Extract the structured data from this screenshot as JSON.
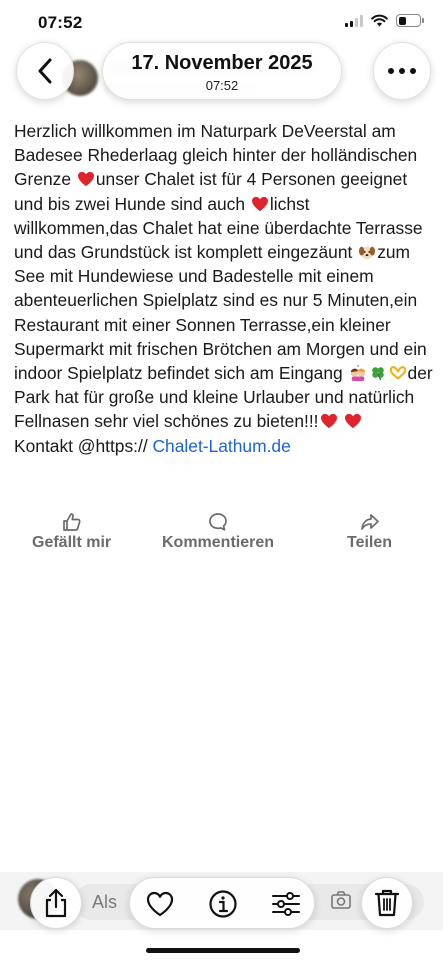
{
  "status_bar": {
    "time": "07:52"
  },
  "header": {
    "date": "17. November 2025",
    "time": "07:52"
  },
  "post": {
    "text_segments": [
      "Herzlich willkommen im Naturpark DeVeerstal am Badesee Rhederlaag gleich hinter der holländischen Grenze ",
      "unser Chalet ist für 4 Personen geeignet und bis zwei Hunde sind auch ",
      "lichst willkommen,das Chalet hat eine überdachte Terrasse und das Grundstück ist komplett eingezäunt ",
      "zum See mit Hundewiese und Badestelle mit einem abenteuerlichen Spielplatz sind es nur 5 Minuten,ein Restaurant mit einer Sonnen Terrasse,ein kleiner Supermarkt mit frischen Brötchen am Morgen und ein indoor Spielplatz befindet sich am Eingang ",
      "der Park hat für große und kleine Urlauber und natürlich Fellnasen sehr viel schönes zu bieten!!!",
      "Kontakt @https:// "
    ],
    "link": "Chalet-Lathum.de",
    "emojis": [
      "red-heart",
      "red-heart",
      "dog-face",
      "kissing-couple",
      "four-leaf-clover",
      "heart-hands",
      "red-heart",
      "red-heart"
    ]
  },
  "actions": {
    "like": "Gefällt mir",
    "comment": "Kommentieren",
    "share": "Teilen"
  },
  "comment_bar": {
    "placeholder": "Als"
  },
  "colors": {
    "link": "#1d64d8",
    "heart": "#e0242e",
    "action_text": "#6b6b6b"
  }
}
